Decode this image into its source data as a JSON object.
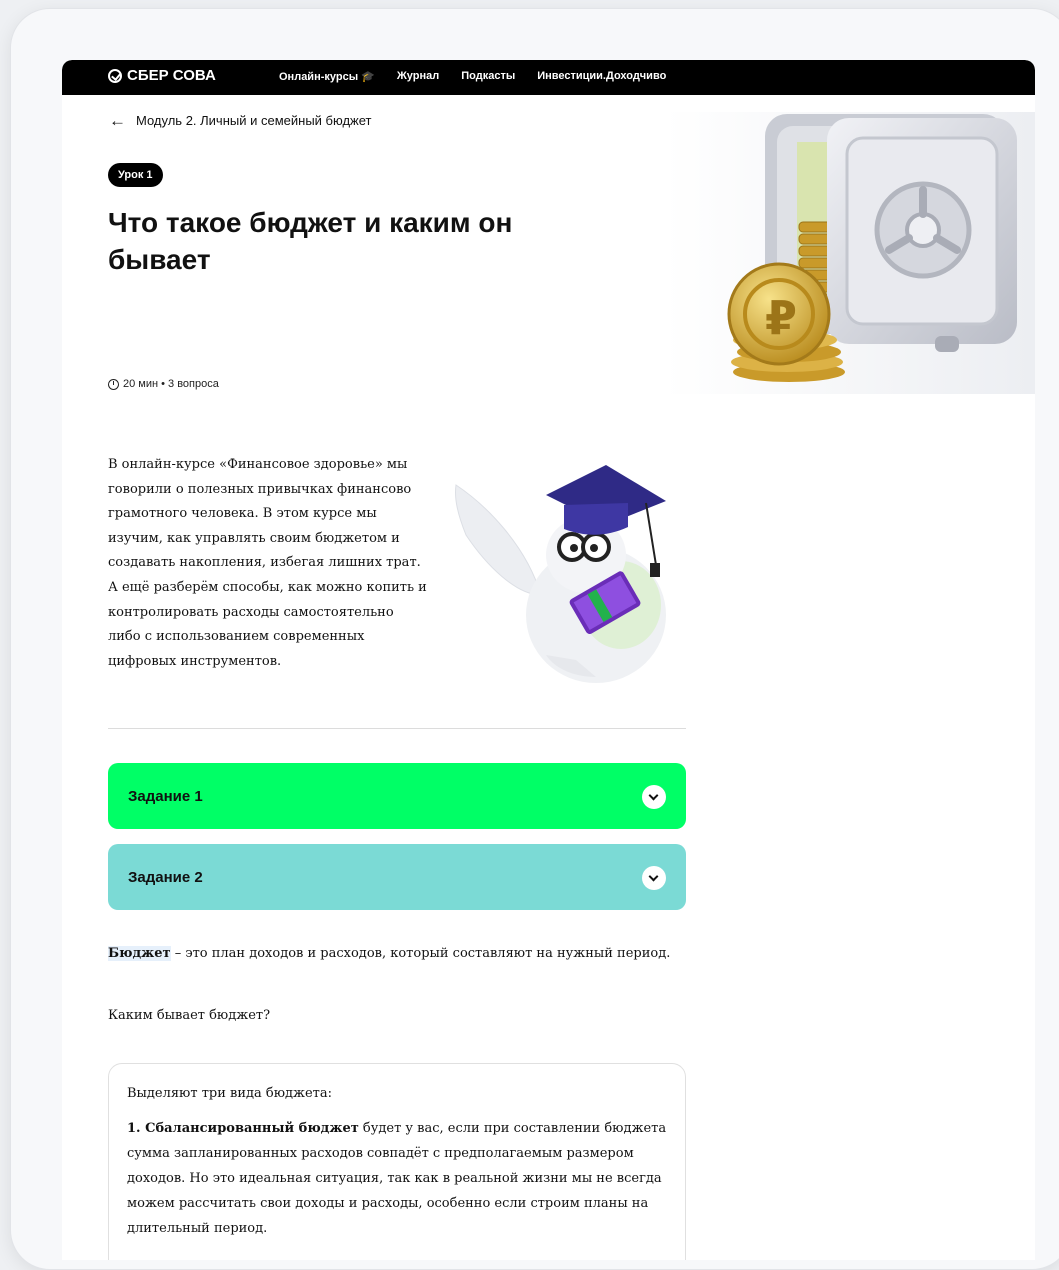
{
  "header": {
    "logo": "СБЕР СОВА",
    "nav": [
      "Онлайн-курсы 🎓",
      "Журнал",
      "Подкасты",
      "Инвестиции.Доходчиво"
    ]
  },
  "breadcrumb": {
    "label": "Модуль 2. Личный и семейный бюджет"
  },
  "lesson": {
    "badge": "Урок 1",
    "title": "Что такое бюджет и каким он бывает",
    "meta": "20 мин • 3 вопроса"
  },
  "intro": "В онлайн-курсе «Финансовое здоровье» мы говорили о полезных привычках финансово грамотного человека. В этом курсе мы изучим, как управлять своим бюджетом и создавать накопления, избегая лишних трат. А ещё разберём способы, как можно копить и контролировать расходы самостоятельно либо с использованием современных цифровых инструментов.",
  "tasks": [
    {
      "label": "Задание 1",
      "color": "#00ff66"
    },
    {
      "label": "Задание 2",
      "color": "#7bdad5"
    }
  ],
  "definition": {
    "term": "Бюджет",
    "text": " – это план доходов и расходов, который составляют на нужный период."
  },
  "question": "Каким бывает бюджет?",
  "types_box": {
    "heading": "Выделяют три вида бюджета:",
    "item1_title": "1. Сбалансированный бюджет",
    "item1_text": " будет у вас, если при составлении бюджета сумма запланированных расходов совпадёт с предполагаемым размером доходов. Но это идеальная ситуация, так как в реальной жизни мы не всегда можем рассчитать свои доходы и расходы, особенно если строим планы на длительный период."
  }
}
